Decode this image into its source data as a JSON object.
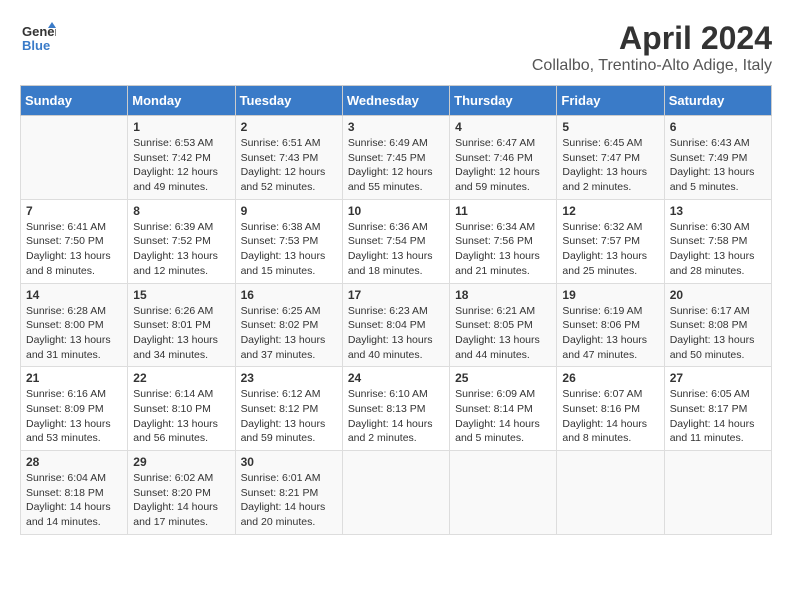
{
  "header": {
    "logo_line1": "General",
    "logo_line2": "Blue",
    "month_title": "April 2024",
    "subtitle": "Collalbo, Trentino-Alto Adige, Italy"
  },
  "days_of_week": [
    "Sunday",
    "Monday",
    "Tuesday",
    "Wednesday",
    "Thursday",
    "Friday",
    "Saturday"
  ],
  "weeks": [
    [
      {
        "day": "",
        "info": ""
      },
      {
        "day": "1",
        "info": "Sunrise: 6:53 AM\nSunset: 7:42 PM\nDaylight: 12 hours\nand 49 minutes."
      },
      {
        "day": "2",
        "info": "Sunrise: 6:51 AM\nSunset: 7:43 PM\nDaylight: 12 hours\nand 52 minutes."
      },
      {
        "day": "3",
        "info": "Sunrise: 6:49 AM\nSunset: 7:45 PM\nDaylight: 12 hours\nand 55 minutes."
      },
      {
        "day": "4",
        "info": "Sunrise: 6:47 AM\nSunset: 7:46 PM\nDaylight: 12 hours\nand 59 minutes."
      },
      {
        "day": "5",
        "info": "Sunrise: 6:45 AM\nSunset: 7:47 PM\nDaylight: 13 hours\nand 2 minutes."
      },
      {
        "day": "6",
        "info": "Sunrise: 6:43 AM\nSunset: 7:49 PM\nDaylight: 13 hours\nand 5 minutes."
      }
    ],
    [
      {
        "day": "7",
        "info": "Sunrise: 6:41 AM\nSunset: 7:50 PM\nDaylight: 13 hours\nand 8 minutes."
      },
      {
        "day": "8",
        "info": "Sunrise: 6:39 AM\nSunset: 7:52 PM\nDaylight: 13 hours\nand 12 minutes."
      },
      {
        "day": "9",
        "info": "Sunrise: 6:38 AM\nSunset: 7:53 PM\nDaylight: 13 hours\nand 15 minutes."
      },
      {
        "day": "10",
        "info": "Sunrise: 6:36 AM\nSunset: 7:54 PM\nDaylight: 13 hours\nand 18 minutes."
      },
      {
        "day": "11",
        "info": "Sunrise: 6:34 AM\nSunset: 7:56 PM\nDaylight: 13 hours\nand 21 minutes."
      },
      {
        "day": "12",
        "info": "Sunrise: 6:32 AM\nSunset: 7:57 PM\nDaylight: 13 hours\nand 25 minutes."
      },
      {
        "day": "13",
        "info": "Sunrise: 6:30 AM\nSunset: 7:58 PM\nDaylight: 13 hours\nand 28 minutes."
      }
    ],
    [
      {
        "day": "14",
        "info": "Sunrise: 6:28 AM\nSunset: 8:00 PM\nDaylight: 13 hours\nand 31 minutes."
      },
      {
        "day": "15",
        "info": "Sunrise: 6:26 AM\nSunset: 8:01 PM\nDaylight: 13 hours\nand 34 minutes."
      },
      {
        "day": "16",
        "info": "Sunrise: 6:25 AM\nSunset: 8:02 PM\nDaylight: 13 hours\nand 37 minutes."
      },
      {
        "day": "17",
        "info": "Sunrise: 6:23 AM\nSunset: 8:04 PM\nDaylight: 13 hours\nand 40 minutes."
      },
      {
        "day": "18",
        "info": "Sunrise: 6:21 AM\nSunset: 8:05 PM\nDaylight: 13 hours\nand 44 minutes."
      },
      {
        "day": "19",
        "info": "Sunrise: 6:19 AM\nSunset: 8:06 PM\nDaylight: 13 hours\nand 47 minutes."
      },
      {
        "day": "20",
        "info": "Sunrise: 6:17 AM\nSunset: 8:08 PM\nDaylight: 13 hours\nand 50 minutes."
      }
    ],
    [
      {
        "day": "21",
        "info": "Sunrise: 6:16 AM\nSunset: 8:09 PM\nDaylight: 13 hours\nand 53 minutes."
      },
      {
        "day": "22",
        "info": "Sunrise: 6:14 AM\nSunset: 8:10 PM\nDaylight: 13 hours\nand 56 minutes."
      },
      {
        "day": "23",
        "info": "Sunrise: 6:12 AM\nSunset: 8:12 PM\nDaylight: 13 hours\nand 59 minutes."
      },
      {
        "day": "24",
        "info": "Sunrise: 6:10 AM\nSunset: 8:13 PM\nDaylight: 14 hours\nand 2 minutes."
      },
      {
        "day": "25",
        "info": "Sunrise: 6:09 AM\nSunset: 8:14 PM\nDaylight: 14 hours\nand 5 minutes."
      },
      {
        "day": "26",
        "info": "Sunrise: 6:07 AM\nSunset: 8:16 PM\nDaylight: 14 hours\nand 8 minutes."
      },
      {
        "day": "27",
        "info": "Sunrise: 6:05 AM\nSunset: 8:17 PM\nDaylight: 14 hours\nand 11 minutes."
      }
    ],
    [
      {
        "day": "28",
        "info": "Sunrise: 6:04 AM\nSunset: 8:18 PM\nDaylight: 14 hours\nand 14 minutes."
      },
      {
        "day": "29",
        "info": "Sunrise: 6:02 AM\nSunset: 8:20 PM\nDaylight: 14 hours\nand 17 minutes."
      },
      {
        "day": "30",
        "info": "Sunrise: 6:01 AM\nSunset: 8:21 PM\nDaylight: 14 hours\nand 20 minutes."
      },
      {
        "day": "",
        "info": ""
      },
      {
        "day": "",
        "info": ""
      },
      {
        "day": "",
        "info": ""
      },
      {
        "day": "",
        "info": ""
      }
    ]
  ]
}
